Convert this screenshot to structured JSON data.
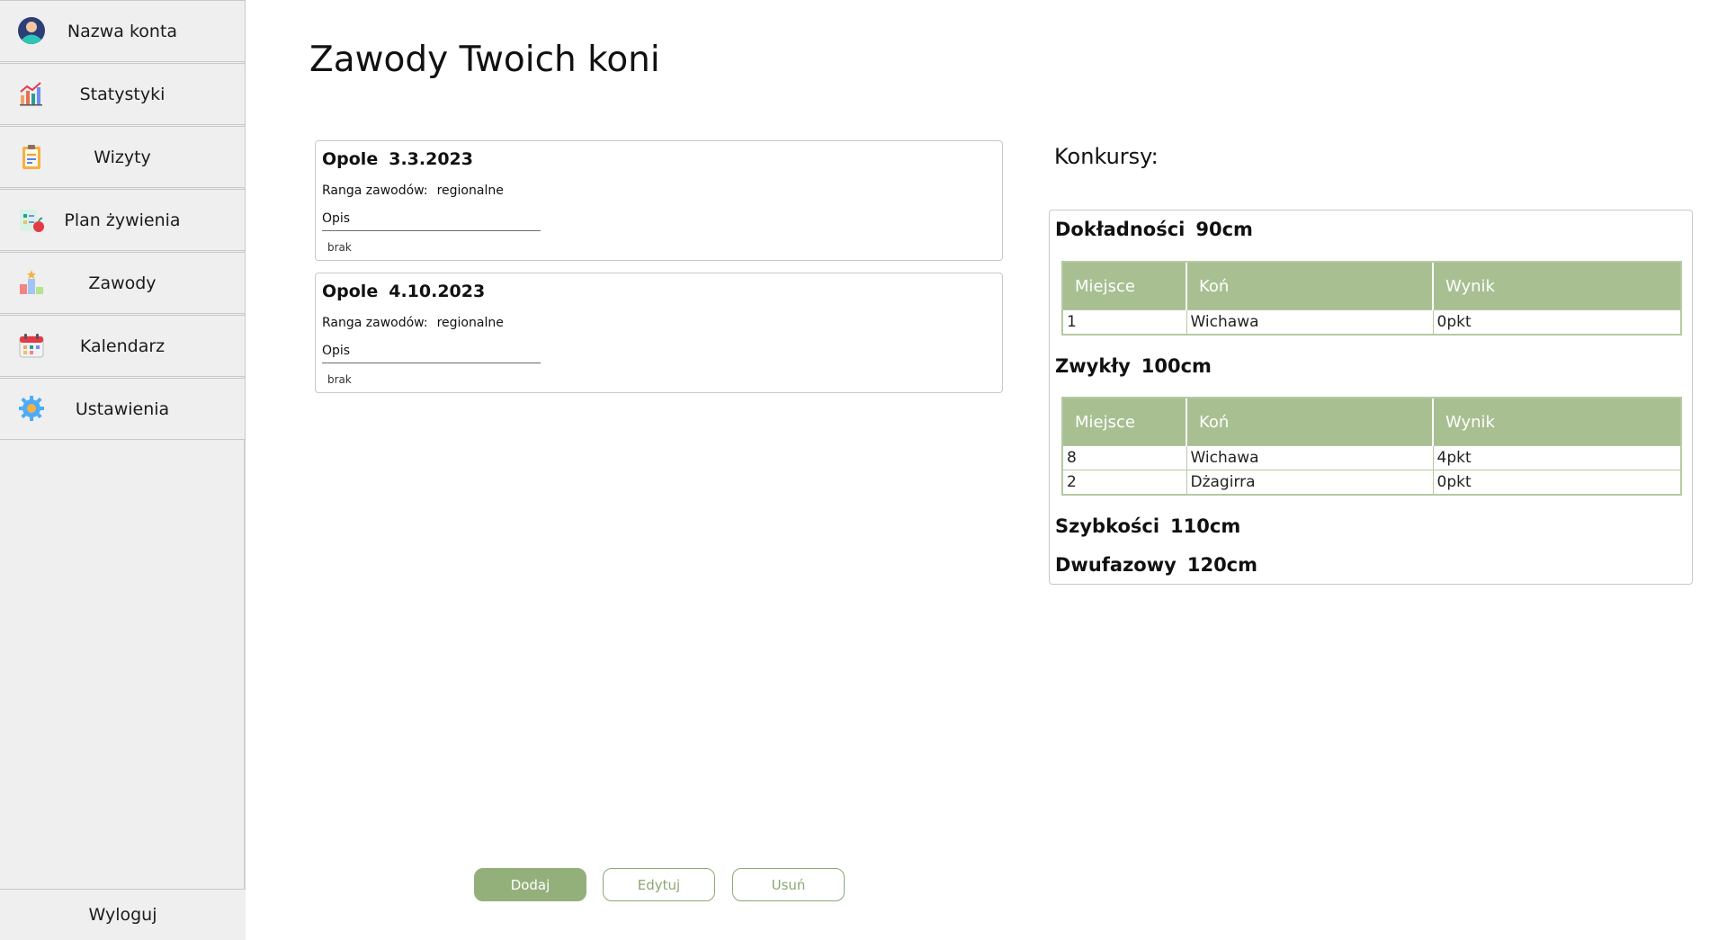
{
  "sidebar": {
    "items": [
      {
        "label": "Nazwa konta",
        "icon": "user-avatar-icon"
      },
      {
        "label": "Statystyki",
        "icon": "bar-chart-icon"
      },
      {
        "label": "Wizyty",
        "icon": "clipboard-icon"
      },
      {
        "label": "Plan żywienia",
        "icon": "meal-plan-icon"
      },
      {
        "label": "Zawody",
        "icon": "podium-icon"
      },
      {
        "label": "Kalendarz",
        "icon": "calendar-icon"
      },
      {
        "label": "Ustawienia",
        "icon": "gear-icon"
      }
    ],
    "logout_label": "Wyloguj"
  },
  "main": {
    "title": "Zawody Twoich koni",
    "competitions": [
      {
        "place": "Opole",
        "date": "3.3.2023",
        "rank_label": "Ranga zawodów:",
        "rank_value": "regionalne",
        "desc_label": "Opis",
        "desc_value": "brak"
      },
      {
        "place": "Opole",
        "date": "4.10.2023",
        "rank_label": "Ranga zawodów:",
        "rank_value": "regionalne",
        "desc_label": "Opis",
        "desc_value": "brak"
      }
    ],
    "contests_title": "Konkursy:",
    "table_headers": [
      "Miejsce",
      "Koń",
      "Wynik"
    ],
    "contests": [
      {
        "name": "Dokładności",
        "height": "90cm",
        "rows": [
          [
            "1",
            "Wichawa",
            "0pkt"
          ]
        ]
      },
      {
        "name": "Zwykły",
        "height": "100cm",
        "rows": [
          [
            "8",
            "Wichawa",
            "4pkt"
          ],
          [
            "2",
            "Dżagirra",
            "0pkt"
          ]
        ]
      },
      {
        "name": "Szybkości",
        "height": "110cm",
        "rows": []
      },
      {
        "name": "Dwufazowy",
        "height": "120cm",
        "rows": []
      }
    ],
    "buttons": {
      "add": "Dodaj",
      "edit": "Edytuj",
      "delete": "Usuń"
    }
  },
  "colors": {
    "accent": "#93b07b",
    "table_header": "#a7bf91",
    "sidebar_bg": "#efefef"
  }
}
